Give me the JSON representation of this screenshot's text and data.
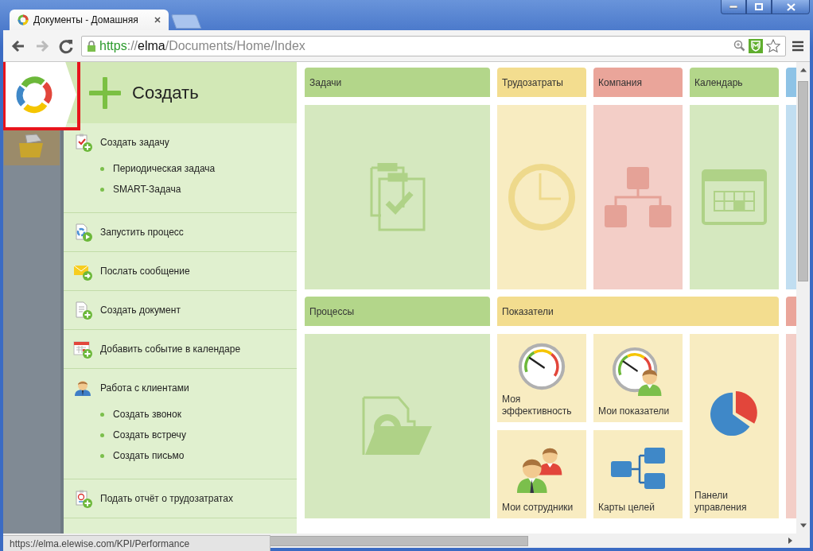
{
  "browser": {
    "tab_title": "Документы - Домашняя",
    "address": [
      {
        "text": "https",
        "kind": "scheme"
      },
      {
        "text": "://",
        "kind": "plain"
      },
      {
        "text": "elma",
        "kind": "host"
      },
      {
        "text": "/Documents/Home/Index",
        "kind": "plain"
      }
    ],
    "status_url": "https://elma.elewise.com/KPI/Performance"
  },
  "create_panel": {
    "title": "Создать",
    "items": [
      {
        "label": "Создать задачу",
        "kind": "task",
        "children": [
          {
            "label": "Периодическая задача"
          },
          {
            "label": "SMART-Задача"
          }
        ]
      },
      {
        "label": "Запустить процесс",
        "kind": "process"
      },
      {
        "label": "Послать сообщение",
        "kind": "message"
      },
      {
        "label": "Создать документ",
        "kind": "document"
      },
      {
        "label": "Добавить событие в календаре",
        "kind": "event"
      },
      {
        "label": "Работа с клиентами",
        "kind": "clients",
        "children": [
          {
            "label": "Создать звонок"
          },
          {
            "label": "Создать встречу"
          },
          {
            "label": "Создать письмо"
          }
        ]
      },
      {
        "label": "Подать отчёт о трудозатратах",
        "kind": "timesheet"
      }
    ]
  },
  "rows": [
    {
      "groups": [
        {
          "title": "Задачи",
          "color": "#b3d68a",
          "kind": "clipboard"
        },
        {
          "title": "Трудозатраты",
          "color": "#f3dd8f",
          "kind": "clock"
        },
        {
          "title": "Компания",
          "color": "#eaa59a",
          "kind": "org"
        },
        {
          "title": "Календарь",
          "color": "#b3d68a",
          "kind": "calendar"
        },
        {
          "color": "#8ec3e6"
        }
      ]
    },
    {
      "groups": [
        {
          "title": "Процессы",
          "color": "#b3d68a",
          "kind": "folder"
        },
        {
          "title": "Показатели",
          "color": "#f3dd8f",
          "tiles": [
            {
              "label": "Моя эффективность",
              "kind": "gauge"
            },
            {
              "label": "Мои показатели",
              "kind": "gauge-person"
            },
            {
              "label": "Мои сотрудники",
              "kind": "people"
            },
            {
              "label": "Карты целей",
              "kind": "tree"
            },
            {
              "label": "Панели управления",
              "kind": "pie"
            }
          ]
        },
        {
          "color": "#eaa59a"
        }
      ]
    }
  ]
}
